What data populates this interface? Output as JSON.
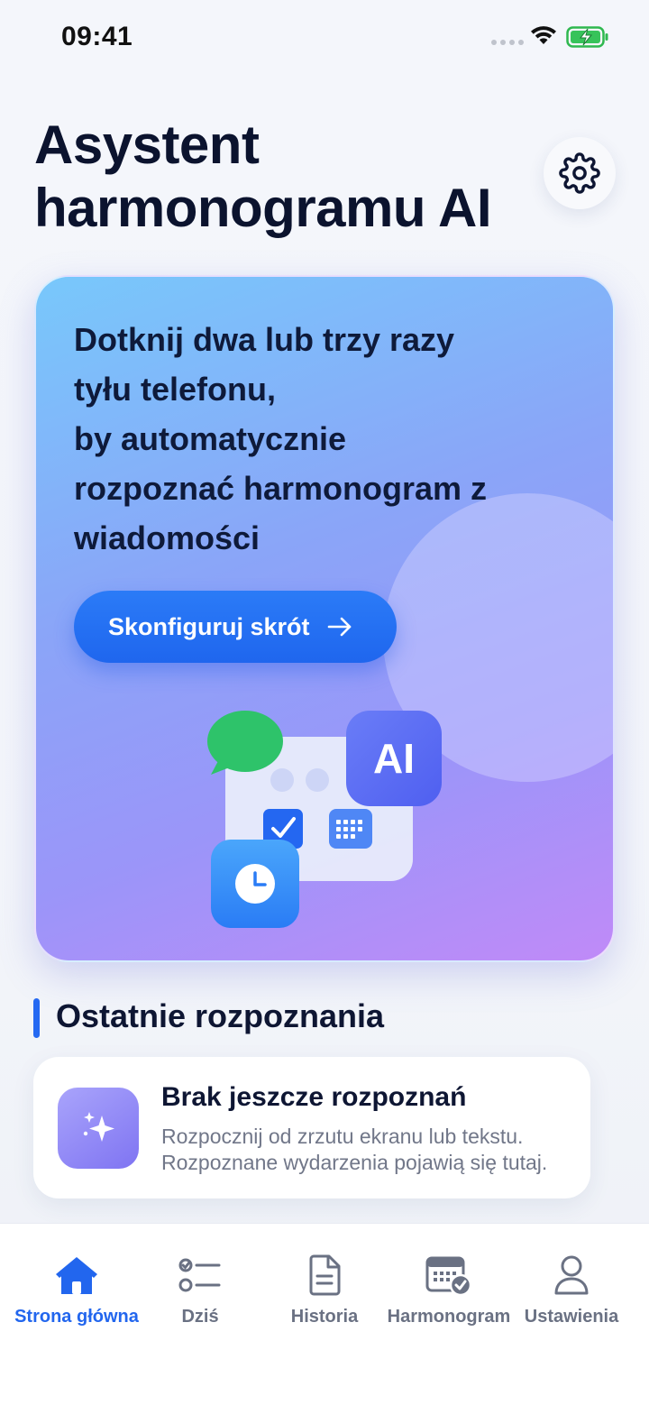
{
  "status_bar": {
    "time": "09:41"
  },
  "header": {
    "title_line1": "Asystent",
    "title_line2": "harmonogramu AI"
  },
  "hero": {
    "lines": [
      "Dotknij dwa lub trzy razy",
      "tyłu telefonu,",
      "by automatycznie",
      "rozpoznać harmonogram z",
      "wiadomości"
    ],
    "button_label": "Skonfiguruj skrót",
    "ai_badge": "AI"
  },
  "recent": {
    "section_title": "Ostatnie rozpoznania",
    "empty_title": "Brak jeszcze rozpoznań",
    "empty_desc_line1": "Rozpocznij od zrzutu ekranu lub tekstu.",
    "empty_desc_line2": "Rozpoznane wydarzenia pojawią się tutaj."
  },
  "tabs": [
    {
      "label": "Strona główna",
      "icon": "home-icon",
      "active": true
    },
    {
      "label": "Dziś",
      "icon": "checklist-icon",
      "active": false
    },
    {
      "label": "Historia",
      "icon": "document-icon",
      "active": false
    },
    {
      "label": "Harmonogram",
      "icon": "calendar-check-icon",
      "active": false
    },
    {
      "label": "Ustawienia",
      "icon": "person-icon",
      "active": false
    }
  ],
  "colors": {
    "accent": "#2266ee",
    "title_text": "#0b132e",
    "muted_text": "#717789",
    "message_bubble": "#2ec36a"
  }
}
